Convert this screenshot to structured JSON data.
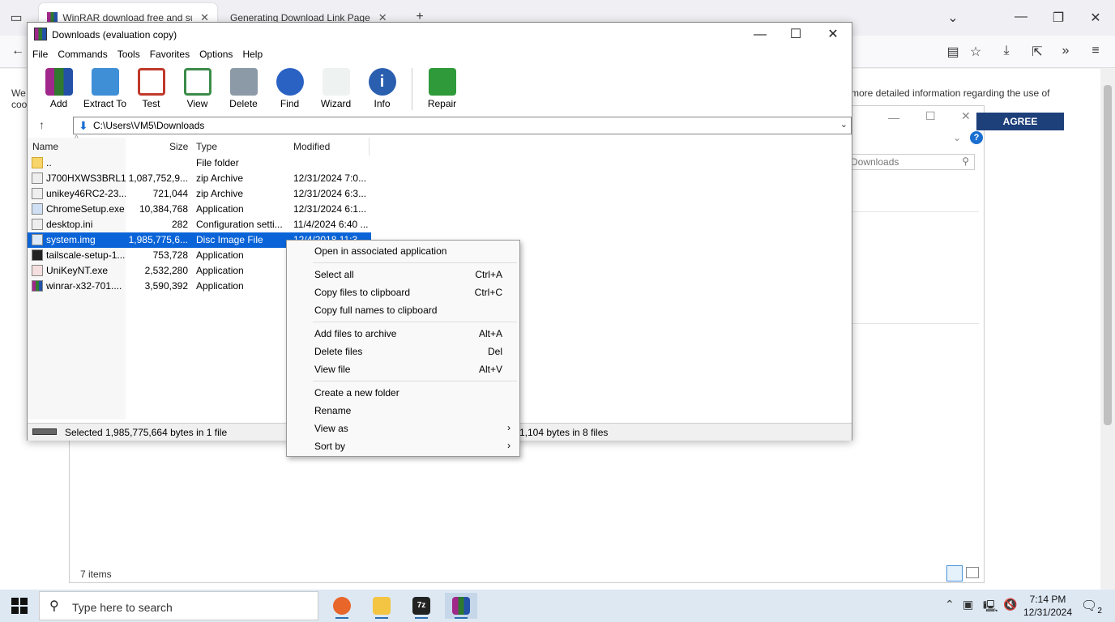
{
  "browser": {
    "tabs": [
      {
        "label": "WinRAR download free and sup",
        "close": "✕"
      },
      {
        "label": "Generating Download Link Page",
        "close": "✕"
      }
    ],
    "new_tab": "+",
    "page": {
      "cookie_text": "more detailed information regarding the use of",
      "cookie_left_1": "We",
      "cookie_left_2": "coo",
      "agree_label": "AGREE"
    }
  },
  "bg_explorer": {
    "search_placeholder": "Downloads",
    "status": "7 items"
  },
  "winrar": {
    "title": "Downloads (evaluation copy)",
    "menu": [
      "File",
      "Commands",
      "Tools",
      "Favorites",
      "Options",
      "Help"
    ],
    "toolbar": [
      {
        "label": "Add",
        "color": "#b3399a"
      },
      {
        "label": "Extract To",
        "color": "#3f8fd6"
      },
      {
        "label": "Test",
        "color": "#c0392b"
      },
      {
        "label": "View",
        "color": "#3c8c4a"
      },
      {
        "label": "Delete",
        "color": "#8c9aa8"
      },
      {
        "label": "Find",
        "color": "#2a62c4"
      },
      {
        "label": "Wizard",
        "color": "#d8d8e8"
      },
      {
        "label": "Info",
        "color": "#2a5fb0"
      },
      {
        "label": "Repair",
        "color": "#2f9a3a"
      }
    ],
    "path": "C:\\Users\\VM5\\Downloads",
    "columns": {
      "name": "Name",
      "size": "Size",
      "type": "Type",
      "modified": "Modified"
    },
    "files": [
      {
        "name": "..",
        "size": "",
        "type": "File folder",
        "modified": ""
      },
      {
        "name": "J700HXWS3BRL1...",
        "size": "1,087,752,9...",
        "type": "zip Archive",
        "modified": "12/31/2024 7:0..."
      },
      {
        "name": "unikey46RC2-23...",
        "size": "721,044",
        "type": "zip Archive",
        "modified": "12/31/2024 6:3..."
      },
      {
        "name": "ChromeSetup.exe",
        "size": "10,384,768",
        "type": "Application",
        "modified": "12/31/2024 6:1..."
      },
      {
        "name": "desktop.ini",
        "size": "282",
        "type": "Configuration setti...",
        "modified": "11/4/2024 6:40 ..."
      },
      {
        "name": "system.img",
        "size": "1,985,775,6...",
        "type": "Disc Image File",
        "modified": "12/4/2018 11:3..."
      },
      {
        "name": "tailscale-setup-1...",
        "size": "753,728",
        "type": "Application",
        "modified": ""
      },
      {
        "name": "UniKeyNT.exe",
        "size": "2,532,280",
        "type": "Application",
        "modified": ""
      },
      {
        "name": "winrar-x32-701....",
        "size": "3,590,392",
        "type": "Application",
        "modified": ""
      }
    ],
    "status_left": "Selected 1,985,775,664 bytes in 1 file",
    "status_right": "1,104 bytes in 8 files"
  },
  "context_menu": {
    "open": "Open in associated application",
    "select_all": {
      "label": "Select all",
      "shortcut": "Ctrl+A"
    },
    "copy_files": {
      "label": "Copy files to clipboard",
      "shortcut": "Ctrl+C"
    },
    "copy_names": {
      "label": "Copy full names to clipboard",
      "shortcut": ""
    },
    "add_files": {
      "label": "Add files to archive",
      "shortcut": "Alt+A"
    },
    "delete_files": {
      "label": "Delete files",
      "shortcut": "Del"
    },
    "view_file": {
      "label": "View file",
      "shortcut": "Alt+V"
    },
    "new_folder": {
      "label": "Create a new folder"
    },
    "rename": {
      "label": "Rename"
    },
    "view_as": {
      "label": "View as"
    },
    "sort_by": {
      "label": "Sort by"
    }
  },
  "taskbar": {
    "search_placeholder": "Type here to search",
    "time": "7:14 PM",
    "date": "12/31/2024",
    "notification_count": "2"
  }
}
